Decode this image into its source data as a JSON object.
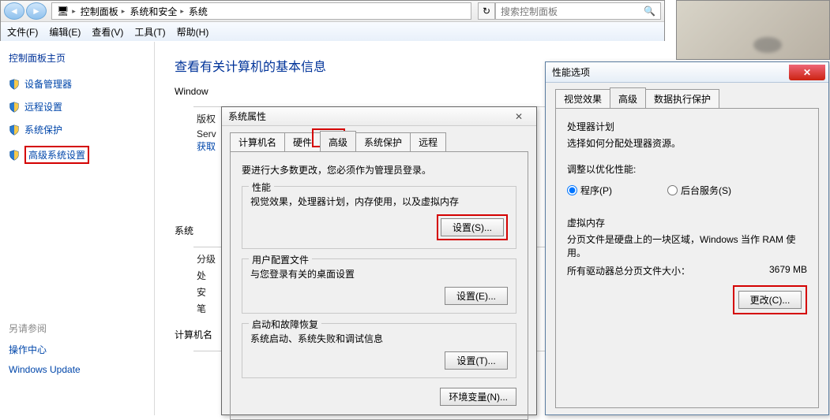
{
  "addressbar": {
    "crumb1": "控制面板",
    "crumb2": "系统和安全",
    "crumb3": "系统",
    "search_placeholder": "搜索控制面板"
  },
  "menubar": {
    "file": "文件(F)",
    "edit": "编辑(E)",
    "view": "查看(V)",
    "tools": "工具(T)",
    "help": "帮助(H)"
  },
  "sidebar": {
    "home": "控制面板主页",
    "items": [
      "设备管理器",
      "远程设置",
      "系统保护",
      "高级系统设置"
    ],
    "also_label": "另请参阅",
    "action_center": "操作中心",
    "windows_update": "Windows Update"
  },
  "content": {
    "heading": "查看有关计算机的基本信息",
    "windows_label": "Window",
    "edition_label": "版权",
    "sp_label": "Serv",
    "get_more": "获取",
    "sys_label": "系统",
    "rating": "分级",
    "processor": "处",
    "ram": "安",
    "pen": "笔",
    "name_label": "计算机名"
  },
  "sysprop": {
    "title": "系统属性",
    "tabs": [
      "计算机名",
      "硬件",
      "高级",
      "系统保护",
      "远程"
    ],
    "admin_note": "要进行大多数更改，您必须作为管理员登录。",
    "perf_title": "性能",
    "perf_desc": "视觉效果，处理器计划，内存使用，以及虚拟内存",
    "perf_btn": "设置(S)...",
    "profile_title": "用户配置文件",
    "profile_desc": "与您登录有关的桌面设置",
    "profile_btn": "设置(E)...",
    "startup_title": "启动和故障恢复",
    "startup_desc": "系统启动、系统失败和调试信息",
    "startup_btn": "设置(T)...",
    "env_btn": "环境变量(N)..."
  },
  "perf": {
    "title": "性能选项",
    "tabs": [
      "视觉效果",
      "高级",
      "数据执行保护"
    ],
    "sched_title": "处理器计划",
    "sched_desc": "选择如何分配处理器资源。",
    "adjust_label": "调整以优化性能:",
    "radio_programs": "程序(P)",
    "radio_services": "后台服务(S)",
    "vm_title": "虚拟内存",
    "vm_desc": "分页文件是硬盘上的一块区域，Windows 当作 RAM 使用。",
    "vm_total_label": "所有驱动器总分页文件大小：",
    "vm_total_value": "3679 MB",
    "change_btn": "更改(C)..."
  }
}
